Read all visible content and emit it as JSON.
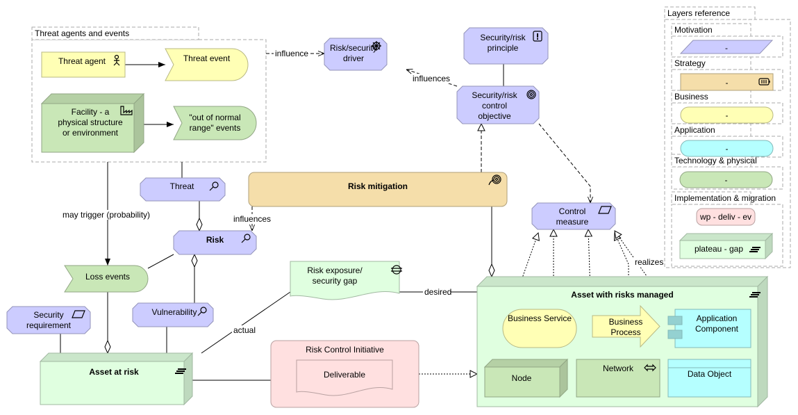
{
  "colors": {
    "motivation": "#ccccff",
    "strategy": "#f5deaa",
    "business": "#ffffb5",
    "application": "#b5ffff",
    "technology": "#c9e7b7",
    "implementation": "#ffe0e0",
    "plateau": "#e0ffe0"
  },
  "groups": {
    "threat_agents": "Threat agents and events",
    "layers": "Layers reference",
    "motivation": "Motivation",
    "strategy": "Strategy",
    "business": "Business",
    "application": "Application",
    "technology": "Technology & physical",
    "implementation": "Implementation & migration"
  },
  "nodes": {
    "threat_agent": {
      "lines": [
        "Threat agent"
      ],
      "icon": "actor-icon"
    },
    "threat_event": {
      "lines": [
        "Threat event"
      ]
    },
    "facility": {
      "lines": [
        "Facility - a",
        "physical structure",
        "or environment"
      ],
      "icon": "facility-icon"
    },
    "out_of_range": {
      "lines": [
        "\"out of normal",
        "range\" events"
      ]
    },
    "driver": {
      "lines": [
        "Risk/security",
        "driver"
      ],
      "icon": "driver-icon"
    },
    "principle": {
      "lines": [
        "Security/risk",
        "principle"
      ],
      "icon": "principle-icon"
    },
    "control_objective": {
      "lines": [
        "Security/risk",
        "control",
        "objective"
      ],
      "icon": "goal-icon"
    },
    "risk_mitigation": {
      "lines": [
        "Risk mitigation"
      ],
      "icon": "course-of-action-icon"
    },
    "control_measure": {
      "lines": [
        "Control",
        "measure"
      ],
      "icon": "requirement-icon"
    },
    "threat": {
      "lines": [
        "Threat"
      ],
      "icon": "assessment-icon"
    },
    "risk": {
      "lines": [
        "Risk"
      ],
      "icon": "assessment-icon"
    },
    "loss_events": {
      "lines": [
        "Loss events"
      ]
    },
    "vulnerability": {
      "lines": [
        "Vulnerability"
      ],
      "icon": "assessment-icon"
    },
    "security_requirement": {
      "lines": [
        "Security",
        "requirement"
      ],
      "icon": "requirement-icon"
    },
    "risk_exposure": {
      "lines": [
        "Risk exposure/",
        "security gap"
      ],
      "icon": "gap-icon"
    },
    "asset_at_risk": {
      "lines": [
        "Asset at risk"
      ],
      "icon": "plateau-icon"
    },
    "risk_control_initiative": {
      "lines": [
        "Risk Control Initiative"
      ]
    },
    "deliverable": {
      "lines": [
        "Deliverable"
      ]
    },
    "asset_managed": {
      "lines": [
        "Asset with risks managed"
      ],
      "icon": "plateau-icon"
    },
    "business_service": {
      "lines": [
        "Business Service"
      ]
    },
    "business_process": {
      "lines": [
        "Business",
        "Process"
      ]
    },
    "application_component": {
      "lines": [
        "Application",
        "Component"
      ]
    },
    "node": {
      "lines": [
        "Node"
      ]
    },
    "network": {
      "lines": [
        "Network"
      ],
      "icon": "network-icon"
    },
    "data_object": {
      "lines": [
        "Data Object"
      ]
    },
    "ref_motivation": {
      "lines": [
        "-"
      ]
    },
    "ref_strategy": {
      "lines": [
        "-"
      ],
      "icon": "capability-icon"
    },
    "ref_business": {
      "lines": [
        "-"
      ]
    },
    "ref_application": {
      "lines": [
        "-"
      ]
    },
    "ref_technology": {
      "lines": [
        "-"
      ]
    },
    "ref_implementation": {
      "lines": [
        "wp - deliv - ev"
      ]
    },
    "ref_plateau": {
      "lines": [
        "plateau - gap"
      ],
      "icon": "plateau-icon"
    }
  },
  "edges": {
    "influence": "influence",
    "influences_driver": "influences",
    "influences_risk": "influences",
    "may_trigger": "may trigger (probability)",
    "actual": "actual",
    "desired": "desired",
    "realizes": "realizes"
  }
}
